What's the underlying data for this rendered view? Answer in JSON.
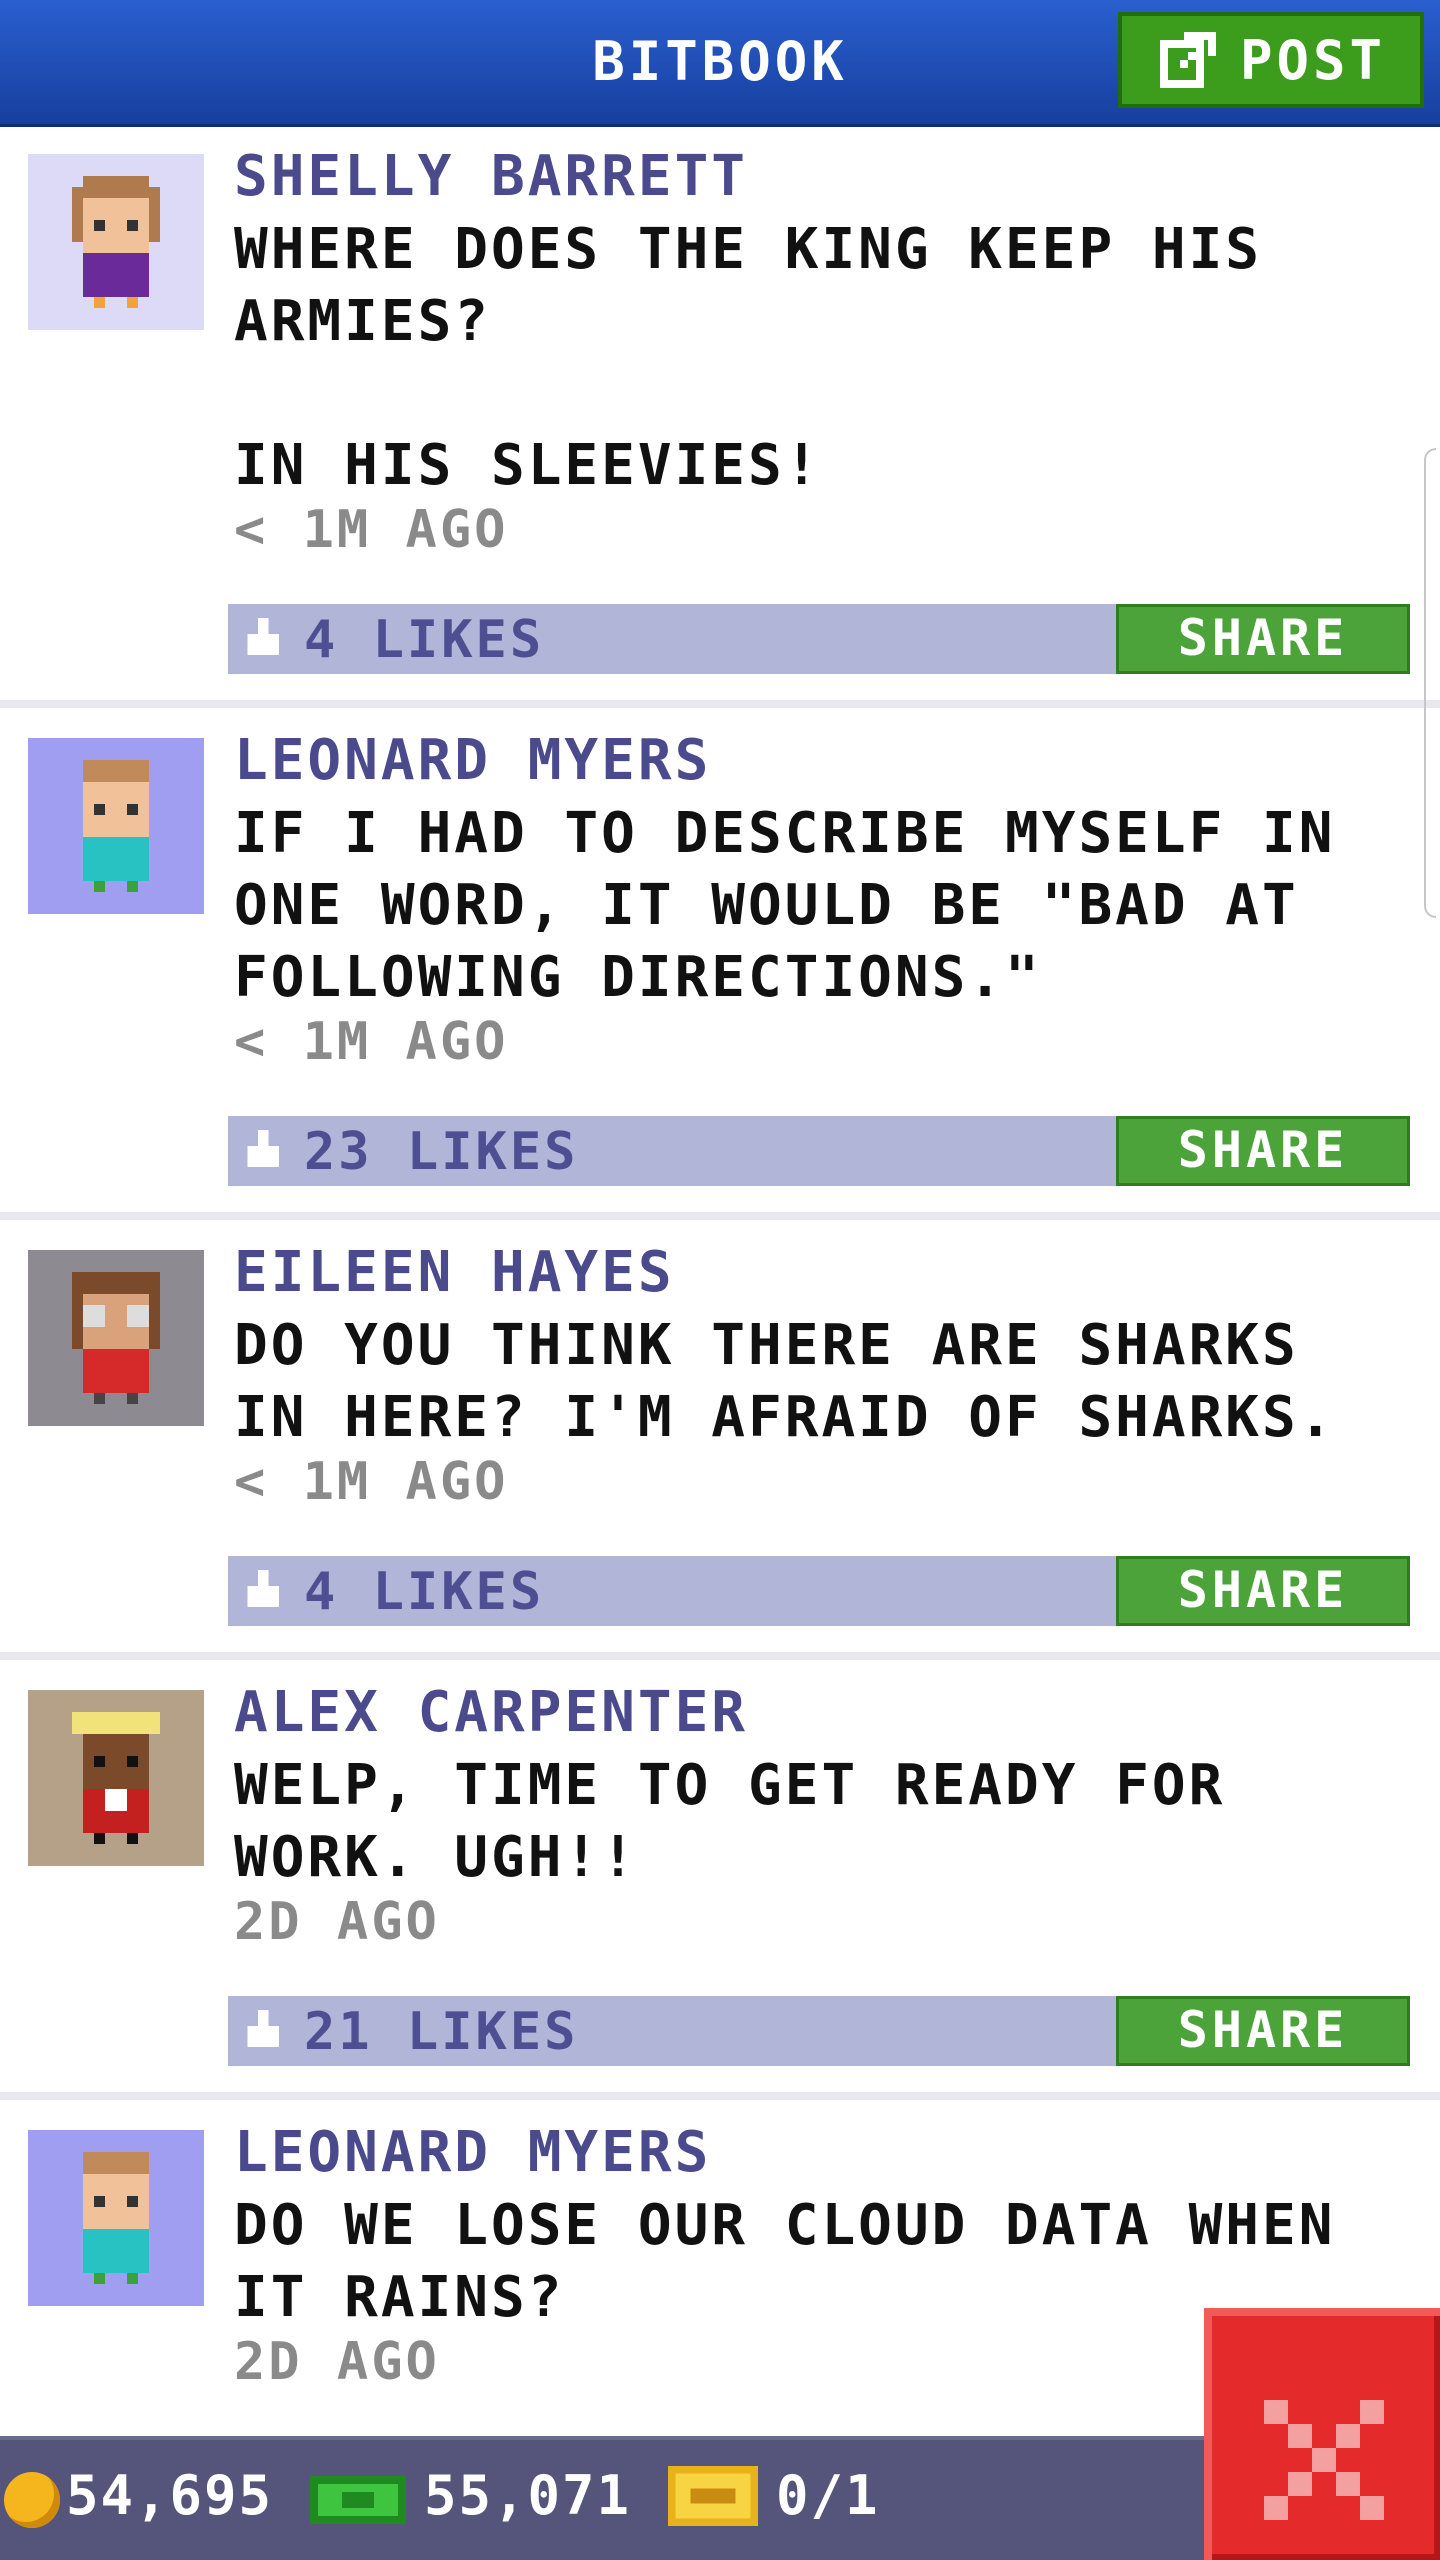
{
  "header": {
    "title": "BITBOOK",
    "post_label": "POST"
  },
  "colors": {
    "header_blue": "#1f4fb8",
    "button_green": "#4ba33a",
    "likes_bar": "#b1b5d8",
    "name_purple": "#4a4a8c",
    "close_red": "#e42a2a"
  },
  "posts": [
    {
      "name": "SHELLY BARRETT",
      "text": "WHERE DOES THE KING KEEP HIS ARMIES?\n\nIN HIS SLEEVIES!",
      "time": "< 1M AGO",
      "likes": "4 LIKES",
      "share": "SHARE",
      "avatar_bg": "#dcdaf7"
    },
    {
      "name": "LEONARD MYERS",
      "text": "IF I HAD TO DESCRIBE MYSELF IN ONE WORD, IT WOULD BE \"BAD AT FOLLOWING DIRECTIONS.\"",
      "time": "< 1M AGO",
      "likes": "23 LIKES",
      "share": "SHARE",
      "avatar_bg": "#9f9ef0"
    },
    {
      "name": "EILEEN HAYES",
      "text": "DO YOU THINK THERE ARE SHARKS IN HERE? I'M AFRAID OF SHARKS.",
      "time": "< 1M AGO",
      "likes": "4 LIKES",
      "share": "SHARE",
      "avatar_bg": "#8e8a91"
    },
    {
      "name": "ALEX CARPENTER",
      "text": "WELP, TIME TO GET READY FOR WORK. UGH!!",
      "time": "2D AGO",
      "likes": "21 LIKES",
      "share": "SHARE",
      "avatar_bg": "#b5a088"
    },
    {
      "name": "LEONARD MYERS",
      "text": "DO WE LOSE OUR CLOUD DATA WHEN IT RAINS?",
      "time": "2D AGO",
      "likes": "",
      "share": "",
      "avatar_bg": "#9f9ef0"
    }
  ],
  "bottom_bar": {
    "coins": "54,695",
    "bux": "55,071",
    "tickets": "0/1"
  }
}
